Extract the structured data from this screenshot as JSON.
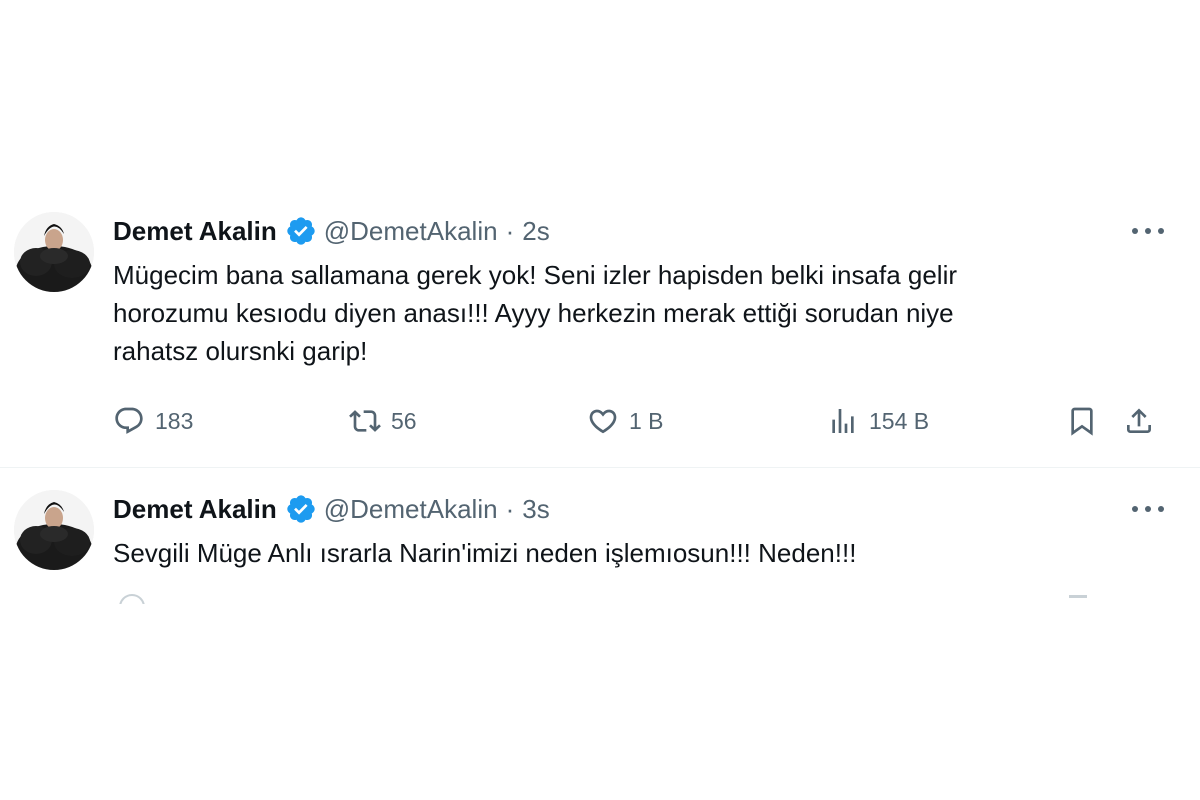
{
  "tweets": [
    {
      "author": {
        "name": "Demet Akalin",
        "handle": "@DemetAkalin",
        "verified": true,
        "verified_color": "#1d9bf0"
      },
      "separator": "·",
      "time": "2s",
      "text_lines": [
        "Mügecim bana sallamana gerek yok! Seni izler hapisden belki insafa gelir",
        "horozumu kesıodu diyen anası!!! Ayyy herkezin merak ettiği sorudan niye",
        "rahatsz olursnki garip!"
      ],
      "stats": {
        "replies": "183",
        "retweets": "56",
        "likes": "1 B",
        "views": "154 B"
      },
      "icons": [
        "reply-icon",
        "retweet-icon",
        "like-icon",
        "views-icon",
        "bookmark-icon",
        "share-icon",
        "more-icon"
      ]
    },
    {
      "author": {
        "name": "Demet Akalin",
        "handle": "@DemetAkalin",
        "verified": true,
        "verified_color": "#1d9bf0"
      },
      "separator": "·",
      "time": "3s",
      "text_lines": [
        "Sevgili Müge Anlı ısrarla Narin'imizi neden işlemıosun!!! Neden!!!"
      ]
    }
  ],
  "colors": {
    "text": "#0f1419",
    "secondary": "#536471",
    "verified": "#1d9bf0",
    "divider": "#eff3f4"
  }
}
